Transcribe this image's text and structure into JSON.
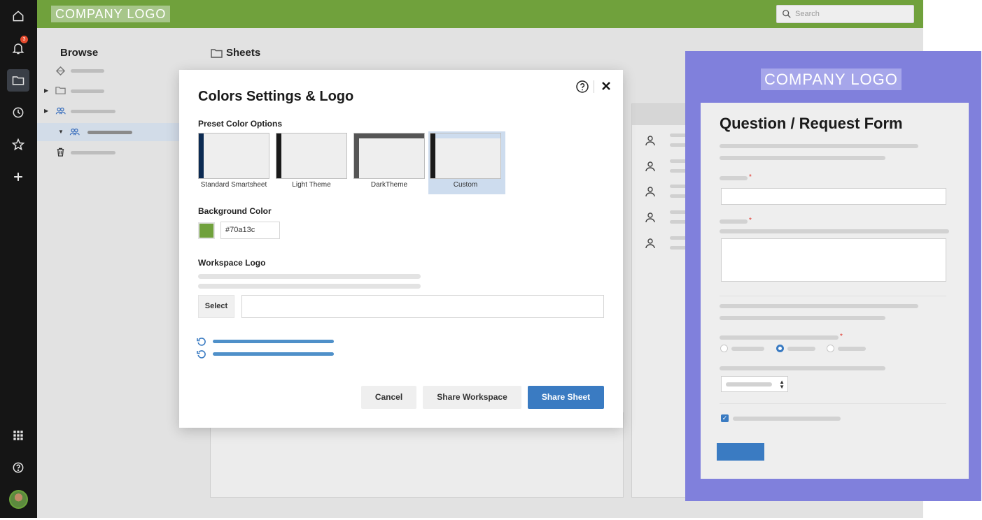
{
  "header": {
    "logo_text": "COMPANY LOGO",
    "search_placeholder": "Search"
  },
  "rail": {
    "notification_count": "3",
    "icons": [
      "home-icon",
      "bell-icon",
      "folder-icon",
      "clock-icon",
      "star-icon",
      "plus-icon",
      "apps-grid-icon",
      "help-icon",
      "avatar"
    ]
  },
  "browse": {
    "title": "Browse"
  },
  "sheets": {
    "title": "Sheets"
  },
  "modal": {
    "title": "Colors Settings & Logo",
    "preset_label": "Preset Color Options",
    "presets": [
      {
        "label": "Standard Smartsheet",
        "stripe_color": "#0b2a52"
      },
      {
        "label": "Light Theme",
        "stripe_color": "#1a1a1a"
      },
      {
        "label": "DarkTheme",
        "stripe_color": "#4a4a4a"
      },
      {
        "label": "Custom",
        "stripe_color": "#1a1a1a",
        "selected": true
      }
    ],
    "background_color_label": "Background Color",
    "background_color_value": "#70a13c",
    "workspace_logo_label": "Workspace Logo",
    "select_button": "Select",
    "cancel_button": "Cancel",
    "share_workspace_button": "Share Workspace",
    "share_sheet_button": "Share Sheet"
  },
  "form_preview": {
    "logo_text": "COMPANY LOGO",
    "title": "Question / Request Form",
    "frame_color": "#8080dc"
  },
  "colors": {
    "header_green": "#70a13c",
    "primary_blue": "#3a7bc2",
    "rail_dark": "#151515"
  }
}
